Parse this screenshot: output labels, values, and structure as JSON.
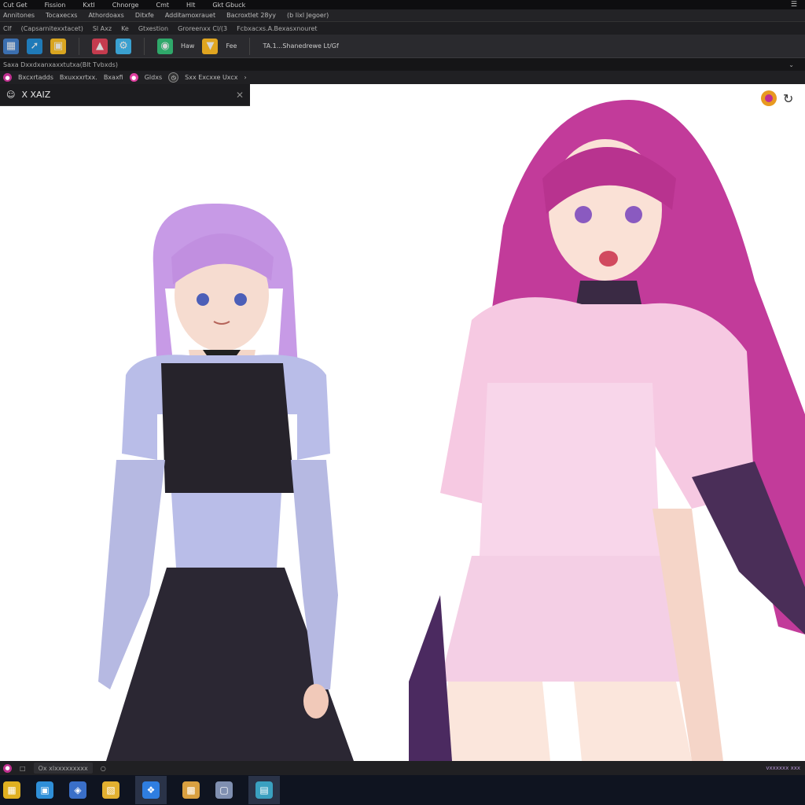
{
  "menu": {
    "items": [
      "Cut Get",
      "Fission",
      "Kxtl",
      "Chnorge",
      "Cmt",
      "Hlt",
      "Gkt Gbuck"
    ],
    "sys_icon": "hamburger-icon"
  },
  "subbar": {
    "items": [
      "Annitones",
      "Tocaxecxs",
      "Athordoaxs",
      "Ditxfe",
      "Additamoxrauet",
      "Bacroxtlet 28yy",
      "(b lixl Jegoer)"
    ]
  },
  "addrbar": {
    "items": [
      "Clf",
      "(Capsarnitexxtacet)",
      "Sl Axz",
      "Ke",
      "Gtxestion",
      "Groreenxx Cl/(3",
      "Fcbxacxs.A.Bexasxnouret"
    ]
  },
  "toolbar": {
    "labels": [
      "Haw",
      "Fee",
      "TA.1...Shanedrewe Lt/Gf"
    ]
  },
  "pathbar": {
    "text": "Saxa Dxxdxanxaxxtutxa(Blt Tvbxds)"
  },
  "tabs": {
    "items": [
      "Bxcxrtadds",
      "Bxuxxxrtxx.",
      "Bxaxfi",
      "Gldxs",
      "Sxx Excxxe Uxcx"
    ]
  },
  "find": {
    "text": "X XAIZ"
  },
  "status": {
    "field": "Ox xlxxxxxxxxx",
    "right": "vxxxxxx xxx"
  },
  "colors": {
    "accent": "#c03090",
    "toolbar_bg": "#2a2a2e",
    "canvas_bg": "#ffffff",
    "taskbar_bg": "#0f1420"
  }
}
